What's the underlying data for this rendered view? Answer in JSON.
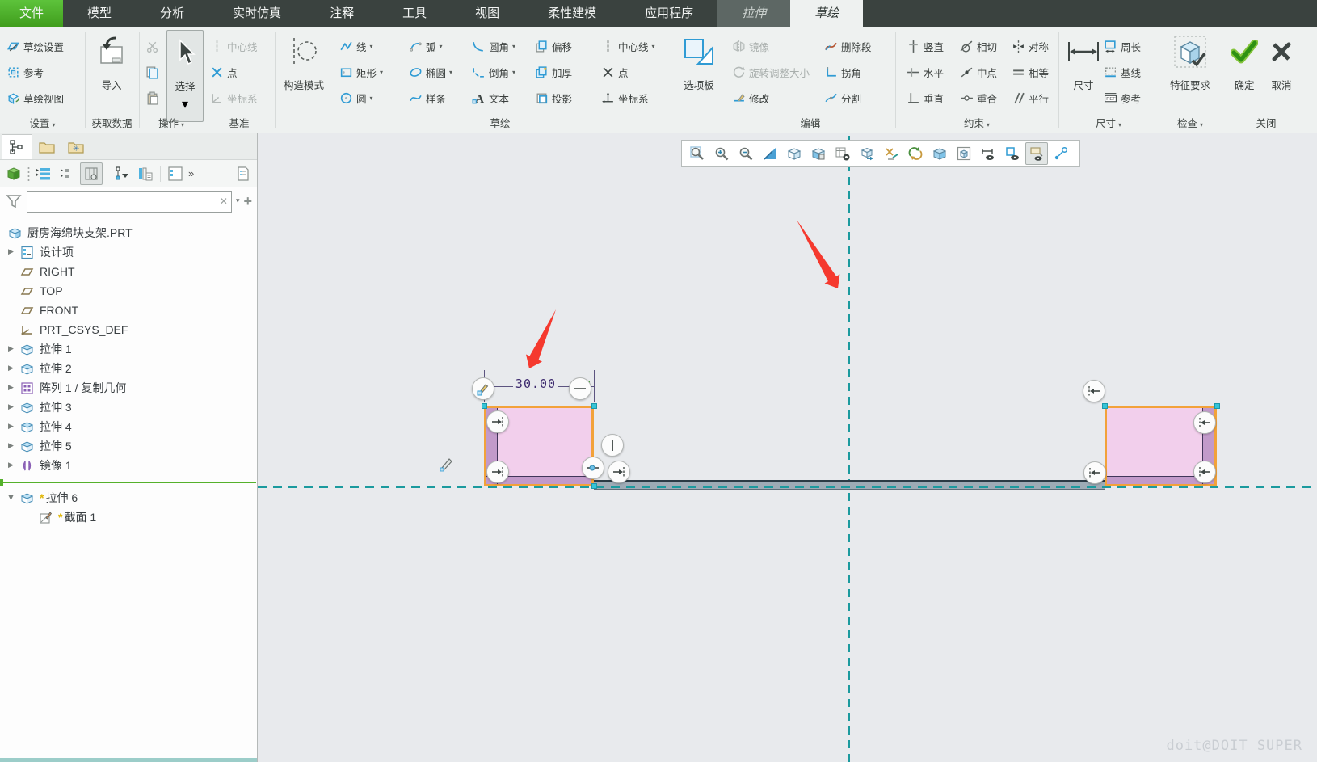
{
  "colors": {
    "accent_green": "#4aad23",
    "centerline_teal": "#1b9a9e",
    "selection_orange": "#f2a23a",
    "sketch_fill_pink": "#f2cfec",
    "overlap_band_purple": "#c29aca",
    "annotation_arrow_red": "#f5392e",
    "dimension_text": "#3d2a6e",
    "icon_blue": "#2f9bd4"
  },
  "glyphs": {
    "caret": "▾",
    "overflow": "»",
    "clear": "✕",
    "add": "+",
    "expand": "▶",
    "collapse": "▼",
    "modified": "*"
  },
  "menu": {
    "file": "文件",
    "model": "模型",
    "analysis": "分析",
    "live_sim": "实时仿真",
    "annotate": "注释",
    "tools": "工具",
    "view": "视图",
    "flex": "柔性建模",
    "apps": "应用程序",
    "extrude": "拉伸",
    "sketch": "草绘"
  },
  "ribbon": {
    "setup": {
      "label": "设置",
      "sketch_setup": "草绘设置",
      "references": "参考",
      "sketch_view": "草绘视图"
    },
    "get_data": {
      "label": "获取数据",
      "import": "导入"
    },
    "operations": {
      "label": "操作",
      "select": "选择"
    },
    "datum": {
      "label": "基准",
      "centerline": "中心线",
      "point": "点",
      "csys": "坐标系"
    },
    "sketching": {
      "label": "草绘",
      "construction": "构造模式",
      "line": "线",
      "rect": "矩形",
      "circle": "圆",
      "arc": "弧",
      "ellipse": "椭圆",
      "spline": "样条",
      "fillet": "圆角",
      "chamfer": "倒角",
      "text": "文本",
      "offset": "偏移",
      "thicken": "加厚",
      "project": "投影",
      "centerline": "中心线",
      "point": "点",
      "csys": "坐标系",
      "palette": "选项板"
    },
    "editing": {
      "label": "编辑",
      "mirror": "镜像",
      "rotate_resize": "旋转调整大小",
      "modify": "修改",
      "delete_seg": "删除段",
      "corner": "拐角",
      "divide": "分割"
    },
    "constrain": {
      "label": "约束",
      "vertical": "竖直",
      "horizontal": "水平",
      "perp": "垂直",
      "tangent": "相切",
      "midpoint": "中点",
      "coincident": "重合",
      "symmetric": "对称",
      "equal": "相等",
      "parallel": "平行"
    },
    "dims": {
      "label": "尺寸",
      "dimension": "尺寸",
      "perimeter": "周长",
      "baseline": "基线",
      "reference": "参考"
    },
    "inspect": {
      "label": "检查",
      "feature_req": "特征要求"
    },
    "close": {
      "label": "关闭",
      "ok": "确定",
      "cancel": "取消"
    }
  },
  "panel": {
    "filter_value": ""
  },
  "tree": {
    "items": [
      {
        "label": "厨房海绵块支架.PRT"
      },
      {
        "label": "设计项"
      },
      {
        "label": "RIGHT"
      },
      {
        "label": "TOP"
      },
      {
        "label": "FRONT"
      },
      {
        "label": "PRT_CSYS_DEF"
      },
      {
        "label": "拉伸 1"
      },
      {
        "label": "拉伸 2"
      },
      {
        "label": "阵列 1 / 复制几何"
      },
      {
        "label": "拉伸 3"
      },
      {
        "label": "拉伸 4"
      },
      {
        "label": "拉伸 5"
      },
      {
        "label": "镜像 1"
      },
      {
        "label": "拉伸 6"
      },
      {
        "label": "截面 1"
      }
    ]
  },
  "sketch": {
    "dim_value": "30.00"
  },
  "watermark": "doit@DOIT SUPER"
}
